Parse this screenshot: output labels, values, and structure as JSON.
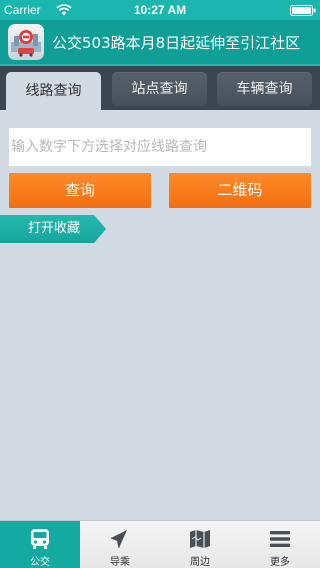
{
  "status_bar": {
    "carrier": "Carrier",
    "time": "10:27 AM",
    "icons": [
      "wifi-icon",
      "battery-icon"
    ]
  },
  "header": {
    "title": "公交503路本月8日起延伸至引江社区",
    "logo_icon": "app-logo-icon"
  },
  "tabs": [
    {
      "label": "线路查询",
      "active": true
    },
    {
      "label": "站点查询",
      "active": false
    },
    {
      "label": "车辆查询",
      "active": false
    }
  ],
  "search": {
    "placeholder": "输入数字下方选择对应线路查询",
    "value": ""
  },
  "buttons": {
    "query": "查询",
    "qr_code": "二维码"
  },
  "favorites": {
    "label": "打开收藏"
  },
  "bottom_nav": [
    {
      "label": "公交",
      "icon": "bus-icon",
      "active": true
    },
    {
      "label": "导乘",
      "icon": "navigation-arrow-icon",
      "active": false
    },
    {
      "label": "周边",
      "icon": "map-icon",
      "active": false
    },
    {
      "label": "更多",
      "icon": "menu-icon",
      "active": false
    }
  ],
  "colors": {
    "status_bar": "#1bb6ad",
    "header": "#0f9f97",
    "tab_strip": "#3c4650",
    "background": "#d2dae3",
    "button_orange": "#f57a1c",
    "accent_teal": "#15aaa1"
  }
}
